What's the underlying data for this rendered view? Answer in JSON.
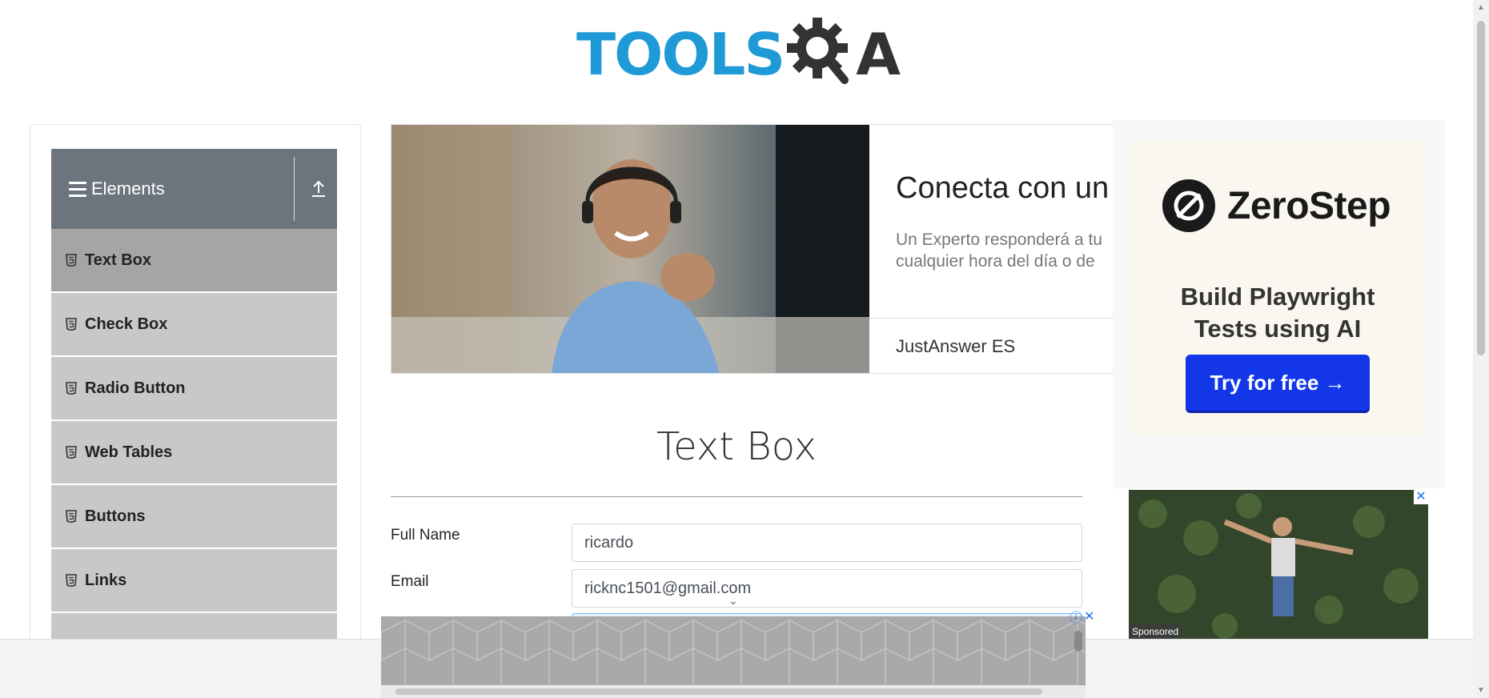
{
  "logo": {
    "text": "TOOLS",
    "suffix": "A"
  },
  "sidebar": {
    "group_title": "Elements",
    "items": [
      {
        "label": "Text Box",
        "active": true
      },
      {
        "label": "Check Box"
      },
      {
        "label": "Radio Button"
      },
      {
        "label": "Web Tables"
      },
      {
        "label": "Buttons"
      },
      {
        "label": "Links"
      },
      {
        "label": ""
      }
    ]
  },
  "banner_ad": {
    "headline": "Conecta con un",
    "body_line1": "Un Experto responderá a tu",
    "body_line2": "cualquier hora del día o de",
    "brand": "JustAnswer ES"
  },
  "right_ad": {
    "brand": "ZeroStep",
    "tagline_line1": "Build Playwright",
    "tagline_line2": "Tests using AI",
    "cta": "Try for free →"
  },
  "sponsored_ad": {
    "label": "Sponsored",
    "close": "✕"
  },
  "main": {
    "title": "Text Box",
    "fields": [
      {
        "label": "Full Name",
        "value": "ricardo"
      },
      {
        "label": "Email",
        "value": "ricknc1501@gmail.com"
      }
    ]
  },
  "bottom_ad": {
    "info": "ⓘ",
    "close": "✕"
  },
  "colors": {
    "accent": "#1f9ad6",
    "sidebar_header": "#6c757d",
    "cta": "#1336e8"
  }
}
